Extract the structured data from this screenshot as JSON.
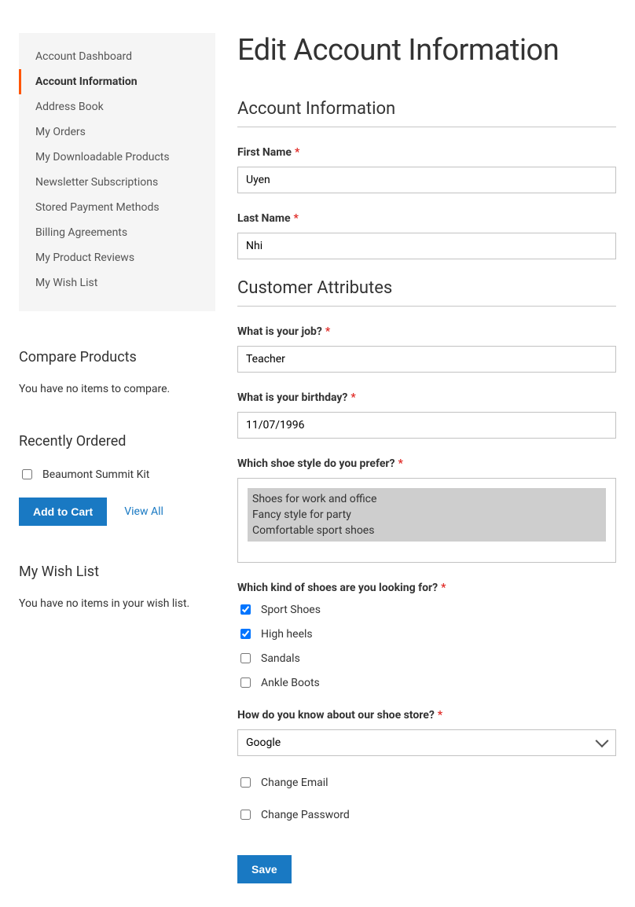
{
  "sidebar": {
    "items": [
      {
        "label": "Account Dashboard",
        "active": false
      },
      {
        "label": "Account Information",
        "active": true
      },
      {
        "label": "Address Book",
        "active": false
      },
      {
        "label": "My Orders",
        "active": false
      },
      {
        "label": "My Downloadable Products",
        "active": false
      },
      {
        "label": "Newsletter Subscriptions",
        "active": false
      },
      {
        "label": "Stored Payment Methods",
        "active": false
      },
      {
        "label": "Billing Agreements",
        "active": false
      },
      {
        "label": "My Product Reviews",
        "active": false
      },
      {
        "label": "My Wish List",
        "active": false
      }
    ]
  },
  "compare": {
    "title": "Compare Products",
    "empty": "You have no items to compare."
  },
  "reorder": {
    "title": "Recently Ordered",
    "item": "Beaumont Summit Kit",
    "addToCart": "Add to Cart",
    "viewAll": "View All"
  },
  "wishlist": {
    "title": "My Wish List",
    "empty": "You have no items in your wish list."
  },
  "page": {
    "title": "Edit Account Information"
  },
  "account": {
    "section": "Account Information",
    "firstNameLabel": "First Name",
    "firstName": "Uyen",
    "lastNameLabel": "Last Name",
    "lastName": "Nhi"
  },
  "attributes": {
    "section": "Customer Attributes",
    "jobLabel": "What is your job?",
    "job": "Teacher",
    "birthdayLabel": "What is your birthday?",
    "birthday": "11/07/1996",
    "shoeStyleLabel": "Which shoe style do you prefer?",
    "shoeStyleOptions": [
      "Shoes for work and office",
      "Fancy style for party",
      "Comfortable sport shoes"
    ],
    "shoeKindLabel": "Which kind of shoes are you looking for?",
    "shoeKindOptions": [
      {
        "label": "Sport Shoes",
        "checked": true
      },
      {
        "label": "High heels",
        "checked": true
      },
      {
        "label": "Sandals",
        "checked": false
      },
      {
        "label": "Ankle Boots",
        "checked": false
      }
    ],
    "sourceLabel": "How do you know about our shoe store?",
    "source": "Google",
    "changeEmail": "Change Email",
    "changePassword": "Change Password"
  },
  "save": "Save",
  "reqMark": "*"
}
